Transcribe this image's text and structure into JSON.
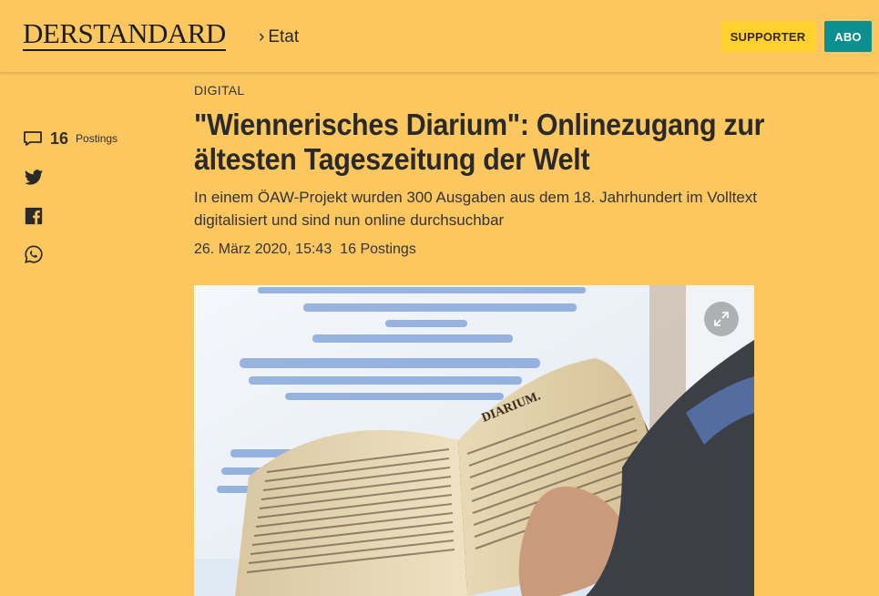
{
  "header": {
    "logo_text": "DERSTANDARD",
    "breadcrumb_separator": "›",
    "breadcrumb_section": "Etat",
    "supporter_label": "SUPPORTER",
    "abo_label": "ABO"
  },
  "sidebar": {
    "postings_count": "16",
    "postings_label": "Postings",
    "share_icons": [
      "twitter-icon",
      "facebook-icon",
      "whatsapp-icon"
    ]
  },
  "article": {
    "kicker": "DIGITAL",
    "title": "\"Wiennerisches Diarium\": Onlinezugang zur ältesten Tageszeitung der Welt",
    "lead": "In einem ÖAW-Projekt wurden 300 Ausgaben aus dem 18. Jahrhundert im Volltext digitalisiert und sind nun online durchsuchbar",
    "date": "26. März 2020, 15:43",
    "postings": "16 Postings"
  },
  "colors": {
    "background": "#fcc75f",
    "supporter_button": "#ffd12e",
    "abo_button": "#0d8f8f"
  }
}
